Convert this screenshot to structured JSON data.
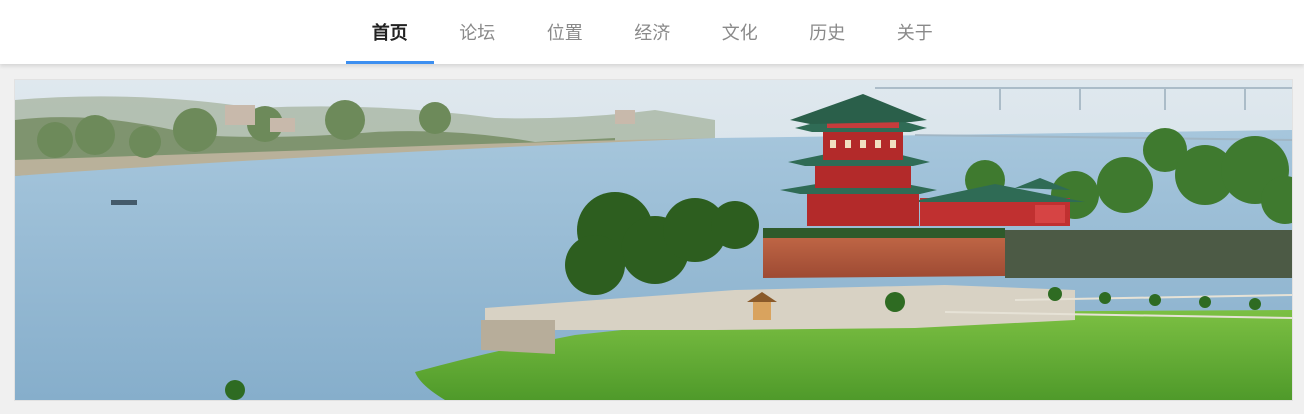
{
  "nav": {
    "items": [
      {
        "label": "首页",
        "active": true
      },
      {
        "label": "论坛",
        "active": false
      },
      {
        "label": "位置",
        "active": false
      },
      {
        "label": "经济",
        "active": false
      },
      {
        "label": "文化",
        "active": false
      },
      {
        "label": "历史",
        "active": false
      },
      {
        "label": "关于",
        "active": false
      }
    ]
  },
  "banner": {
    "image_subject": "riverside pavilion tower with green lawn",
    "colors": {
      "accent": "#3d8ff0",
      "water": "#8fb8d4",
      "grass": "#5faa34",
      "wall": "#b25a3e",
      "roof": "#2f6b55",
      "tower": "#b32a2a"
    }
  }
}
